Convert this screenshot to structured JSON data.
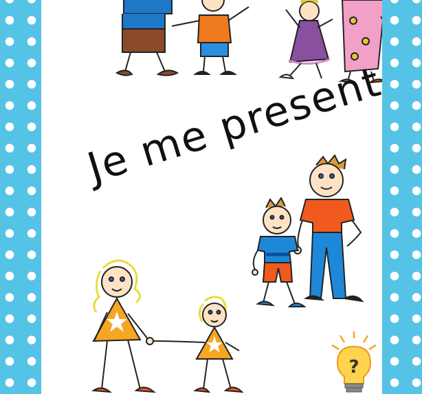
{
  "title": "Je me presente",
  "colors": {
    "border": "#55c3e6",
    "dot": "#ffffff",
    "card": "#ffffff",
    "boy_shirt": "#1e88d8",
    "man_shirt": "#f05a1e",
    "girl_dress": "#f5a623",
    "mom_dress": "#f3a0c8",
    "purple_dress": "#8a4f9e",
    "bulb": "#ffd34d"
  },
  "icons": [
    "family-top-illustration",
    "father-son-illustration",
    "mother-daughter-illustration",
    "lightbulb-question-icon"
  ]
}
